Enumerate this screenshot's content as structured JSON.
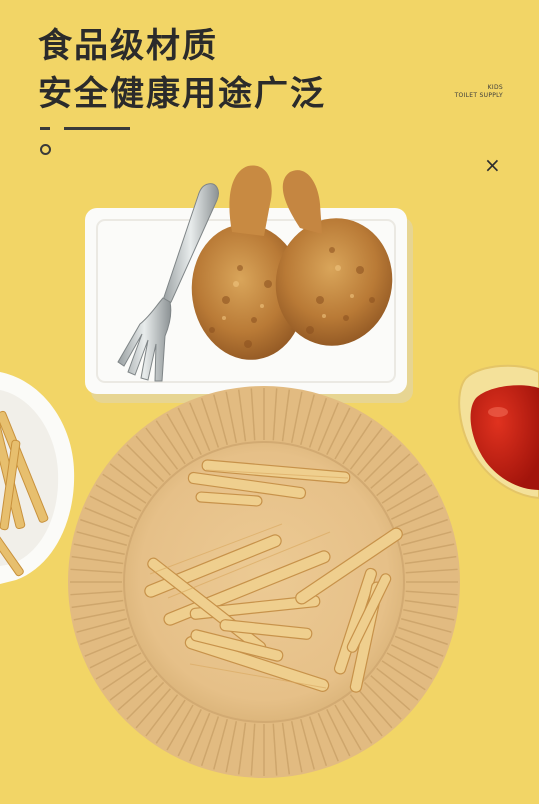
{
  "headline": {
    "line1": "食品级材质",
    "line2": "安全健康用途广泛"
  },
  "brand": {
    "line1": "KIDS",
    "line2": "TOILET SUPPLY"
  },
  "close_symbol": "×",
  "colors": {
    "background": "#f2d566",
    "headline": "#2b2b2b",
    "paper_liner": "#e6c189",
    "plate": "#ffffff",
    "ketchup": "#c81d12"
  },
  "icons": [
    "close-icon",
    "ring-icon"
  ]
}
